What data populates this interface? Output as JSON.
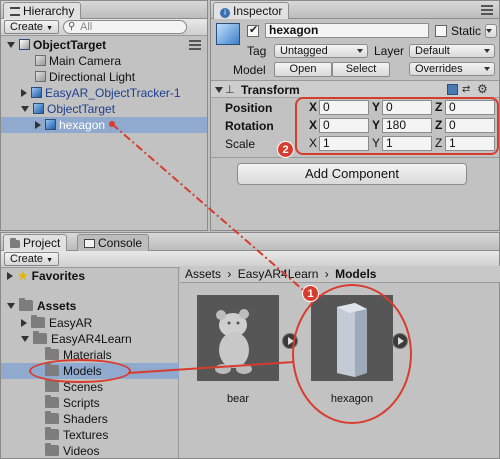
{
  "hierarchy": {
    "tab_label": "Hierarchy",
    "create_label": "Create",
    "search_placeholder": "All",
    "root": "ObjectTarget",
    "items": [
      {
        "label": "Main Camera"
      },
      {
        "label": "Directional Light"
      },
      {
        "label": "EasyAR_ObjectTracker-1"
      },
      {
        "label": "ObjectTarget"
      },
      {
        "label": "hexagon"
      }
    ]
  },
  "inspector": {
    "tab_label": "Inspector",
    "object_name": "hexagon",
    "static_label": "Static",
    "tag_label": "Tag",
    "tag_value": "Untagged",
    "layer_label": "Layer",
    "layer_value": "Default",
    "model_label": "Model",
    "open_label": "Open",
    "select_label": "Select",
    "overrides_label": "Overrides",
    "transform": {
      "title": "Transform",
      "rows": [
        {
          "label": "Position",
          "x": "0",
          "y": "0",
          "z": "0"
        },
        {
          "label": "Rotation",
          "x": "0",
          "y": "180",
          "z": "0"
        },
        {
          "label": "Scale",
          "x": "1",
          "y": "1",
          "z": "1"
        }
      ],
      "axis_x": "X",
      "axis_y": "Y",
      "axis_z": "Z"
    },
    "add_component_label": "Add Component"
  },
  "project": {
    "tab_label": "Project",
    "console_tab_label": "Console",
    "create_label": "Create",
    "favorites_label": "Favorites",
    "assets_label": "Assets",
    "folders": [
      "EasyAR",
      "EasyAR4Learn",
      "Materials",
      "Models",
      "Scenes",
      "Scripts",
      "Shaders",
      "Textures",
      "Videos"
    ],
    "breadcrumb": {
      "part1": "Assets",
      "part2": "EasyAR4Learn",
      "current": "Models",
      "sep": "›"
    },
    "assets": [
      {
        "label": "bear"
      },
      {
        "label": "hexagon"
      }
    ]
  },
  "annotations": {
    "badge1": "1",
    "badge2": "2",
    "accent": "#d83c2e"
  }
}
